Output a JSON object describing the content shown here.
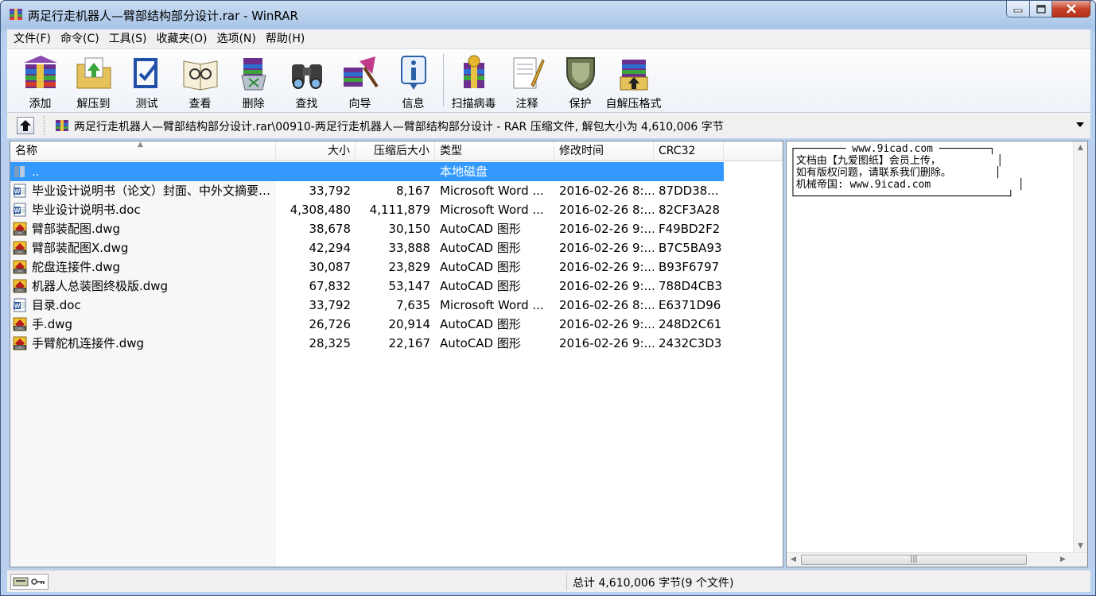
{
  "window": {
    "title": "两足行走机器人—臂部结构部分设计.rar - WinRAR"
  },
  "menu": [
    {
      "label": "文件(F)"
    },
    {
      "label": "命令(C)"
    },
    {
      "label": "工具(S)"
    },
    {
      "label": "收藏夹(O)"
    },
    {
      "label": "选项(N)"
    },
    {
      "label": "帮助(H)"
    }
  ],
  "toolbar": [
    {
      "label": "添加",
      "icon": "add-archive-icon"
    },
    {
      "label": "解压到",
      "icon": "extract-to-icon"
    },
    {
      "label": "测试",
      "icon": "test-icon"
    },
    {
      "label": "查看",
      "icon": "view-icon"
    },
    {
      "label": "删除",
      "icon": "delete-icon"
    },
    {
      "label": "查找",
      "icon": "find-icon"
    },
    {
      "label": "向导",
      "icon": "wizard-icon"
    },
    {
      "label": "信息",
      "icon": "info-icon"
    },
    {
      "label": "扫描病毒",
      "icon": "virus-scan-icon"
    },
    {
      "label": "注释",
      "icon": "comment-icon"
    },
    {
      "label": "保护",
      "icon": "protect-icon"
    },
    {
      "label": "自解压格式",
      "icon": "sfx-icon"
    }
  ],
  "address": {
    "path": "两足行走机器人—臂部结构部分设计.rar\\00910-两足行走机器人—臂部结构部分设计 - RAR 压缩文件, 解包大小为 4,610,006 字节"
  },
  "columns": {
    "name": "名称",
    "size": "大小",
    "packed": "压缩后大小",
    "type": "类型",
    "modified": "修改时间",
    "crc": "CRC32"
  },
  "files": [
    {
      "name": "..",
      "size": "",
      "packed": "",
      "type": "本地磁盘",
      "modified": "",
      "crc": "",
      "icon": "folder-up-icon",
      "selected": true
    },
    {
      "name": "毕业设计说明书（论文）封面、中外文摘要....",
      "size": "33,792",
      "packed": "8,167",
      "type": "Microsoft Word ...",
      "modified": "2016-02-26 8:...",
      "crc": "87DD38...",
      "icon": "word-doc-icon"
    },
    {
      "name": "毕业设计说明书.doc",
      "size": "4,308,480",
      "packed": "4,111,879",
      "type": "Microsoft Word ...",
      "modified": "2016-02-26 8:...",
      "crc": "82CF3A28",
      "icon": "word-doc-icon"
    },
    {
      "name": "臂部装配图.dwg",
      "size": "38,678",
      "packed": "30,150",
      "type": "AutoCAD 图形",
      "modified": "2016-02-26 9:...",
      "crc": "F49BD2F2",
      "icon": "dwg-icon"
    },
    {
      "name": "臂部装配图X.dwg",
      "size": "42,294",
      "packed": "33,888",
      "type": "AutoCAD 图形",
      "modified": "2016-02-26 9:...",
      "crc": "B7C5BA93",
      "icon": "dwg-icon"
    },
    {
      "name": "舵盘连接件.dwg",
      "size": "30,087",
      "packed": "23,829",
      "type": "AutoCAD 图形",
      "modified": "2016-02-26 9:...",
      "crc": "B93F6797",
      "icon": "dwg-icon"
    },
    {
      "name": "机器人总装图终极版.dwg",
      "size": "67,832",
      "packed": "53,147",
      "type": "AutoCAD 图形",
      "modified": "2016-02-26 9:...",
      "crc": "788D4CB3",
      "icon": "dwg-icon"
    },
    {
      "name": "目录.doc",
      "size": "33,792",
      "packed": "7,635",
      "type": "Microsoft Word ...",
      "modified": "2016-02-26 8:...",
      "crc": "E6371D96",
      "icon": "word-doc-icon"
    },
    {
      "name": "手.dwg",
      "size": "26,726",
      "packed": "20,914",
      "type": "AutoCAD 图形",
      "modified": "2016-02-26 9:...",
      "crc": "248D2C61",
      "icon": "dwg-icon"
    },
    {
      "name": "手臂舵机连接件.dwg",
      "size": "28,325",
      "packed": "22,167",
      "type": "AutoCAD 图形",
      "modified": "2016-02-26 9:...",
      "crc": "2432C3D3",
      "icon": "dwg-icon"
    }
  ],
  "comment": {
    "text": "┌──────── www.9icad.com ────────┐\n│文档由【九爱图纸】会员上传，         │\n│如有版权问题，请联系我们删除。       │\n│机械帝国: www.9icad.com              │\n└──────────────────────────────────┘"
  },
  "status": {
    "total": "总计 4,610,006 字节(9 个文件)"
  }
}
